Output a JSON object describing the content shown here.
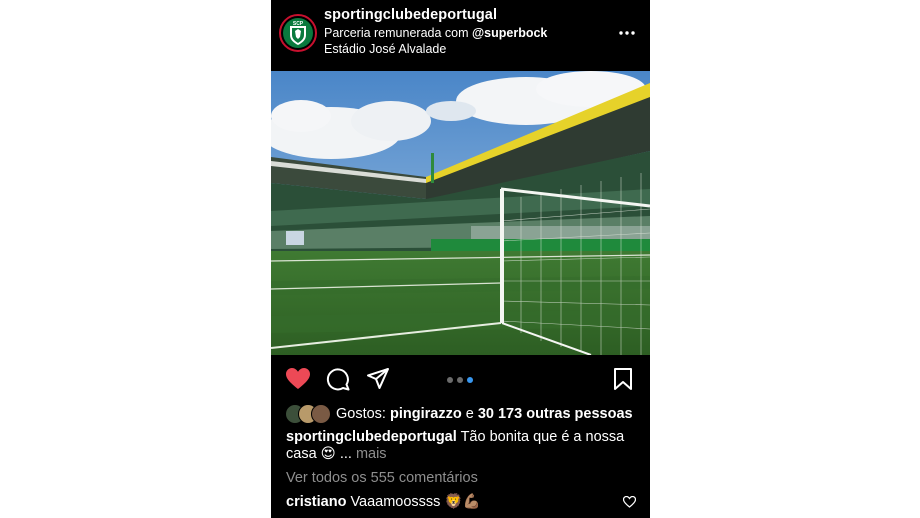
{
  "post": {
    "username": "sportingclubedeportugal",
    "partnership_prefix": "Parceria remunerada com ",
    "partnership_handle": "@superbock",
    "location": "Estádio José Alvalade",
    "avatar_text": "SCP"
  },
  "actions": {
    "liked": true,
    "carousel_total": 3,
    "carousel_active": 3
  },
  "likes": {
    "prefix": "Gostos: ",
    "first_liker": "pingirazzo",
    "joiner": " e ",
    "others": "30 173 outras pessoas"
  },
  "caption": {
    "username": "sportingclubedeportugal",
    "text": "Tão bonita que é a nossa casa 😍",
    "ellipsis": "...",
    "more": "mais"
  },
  "comments": {
    "view_all": "Ver todos os 555 comentários",
    "top_comment": {
      "username": "cristiano",
      "text": "Vaaamoossss 🦁💪🏽"
    }
  },
  "colors": {
    "background": "#000000",
    "like_red": "#ed4956",
    "muted": "#8e8e8e",
    "carousel_active": "#3897f0",
    "club_green": "#0a7a3e"
  },
  "icons": {
    "more": "more-horizontal-icon",
    "like": "heart-icon",
    "comment": "comment-icon",
    "share": "send-icon",
    "save": "bookmark-icon",
    "comment_like": "small-heart-icon"
  }
}
